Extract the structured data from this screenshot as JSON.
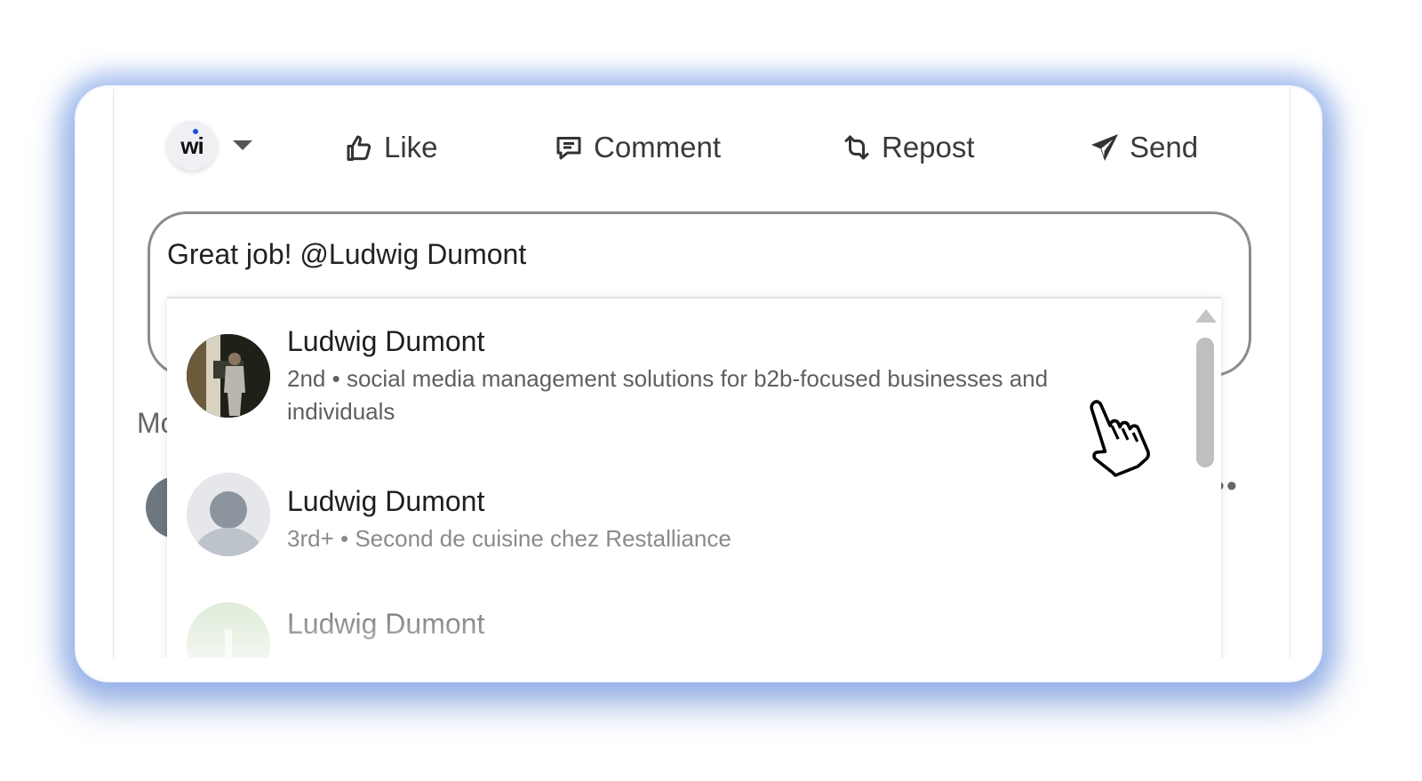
{
  "actor": {
    "initials": "wi",
    "accent": "#1d4ed8"
  },
  "actions": {
    "like": "Like",
    "comment": "Comment",
    "repost": "Repost",
    "send": "Send"
  },
  "comment_box": {
    "text": "Great job! @Ludwig Dumont"
  },
  "background": {
    "label": "Mo",
    "more_dots": "••"
  },
  "mentions": [
    {
      "name": "Ludwig Dumont",
      "degree": "2nd",
      "separator": "•",
      "headline": "social media management solutions for b2b-focused businesses and individuals"
    },
    {
      "name": "Ludwig Dumont",
      "degree": "3rd+",
      "separator": "•",
      "headline": "Second de cuisine chez Restalliance"
    },
    {
      "name": "Ludwig Dumont"
    }
  ],
  "icons": [
    "like-icon",
    "comment-icon",
    "repost-icon",
    "send-icon",
    "caret-down-icon",
    "pointer-hand-icon"
  ]
}
